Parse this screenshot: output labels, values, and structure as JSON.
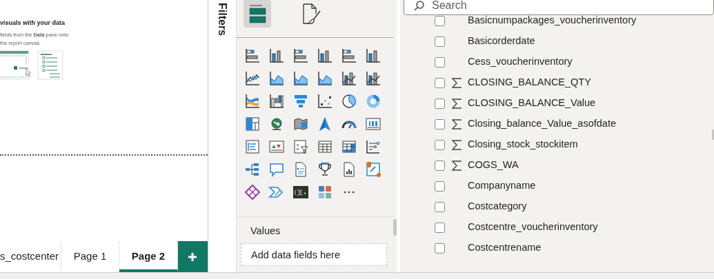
{
  "canvas": {
    "title": "visuals with your data",
    "hint": "fields from the **Data** pane onto the report canvas."
  },
  "filters_pane": {
    "title": "Filters"
  },
  "page_tabs": [
    {
      "label": "s_costcenter",
      "selected": false
    },
    {
      "label": "Page 1",
      "selected": false
    },
    {
      "label": "Page 2",
      "selected": true
    }
  ],
  "visualizations_pane": {
    "build_tab_selected": true,
    "format_tab_selected": false,
    "values_label": "Values",
    "values_placeholder": "Add data fields here"
  },
  "data_pane": {
    "search_placeholder": "Search",
    "fields": [
      {
        "name": "Basicnumpackages_voucherinventory",
        "measure": false,
        "checked": false
      },
      {
        "name": "Basicorderdate",
        "measure": false,
        "checked": false
      },
      {
        "name": "Cess_voucherinventory",
        "measure": false,
        "checked": false
      },
      {
        "name": "CLOSING_BALANCE_QTY",
        "measure": true,
        "checked": false
      },
      {
        "name": "CLOSING_BALANCE_Value",
        "measure": true,
        "checked": false
      },
      {
        "name": "Closing_balance_Value_asofdate",
        "measure": true,
        "checked": false
      },
      {
        "name": "Closing_stock_stockitem",
        "measure": true,
        "checked": false
      },
      {
        "name": "COGS_WA",
        "measure": true,
        "checked": false
      },
      {
        "name": "Companyname",
        "measure": false,
        "checked": false
      },
      {
        "name": "Costcategory",
        "measure": false,
        "checked": false
      },
      {
        "name": "Costcentre_voucherinventory",
        "measure": false,
        "checked": false
      },
      {
        "name": "Costcentrename",
        "measure": false,
        "checked": false
      }
    ]
  }
}
